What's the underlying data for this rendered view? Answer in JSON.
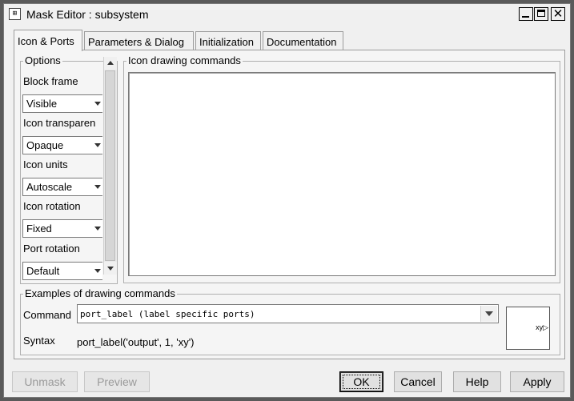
{
  "window": {
    "title": "Mask Editor : subsystem"
  },
  "tabs": [
    {
      "label": "Icon & Ports"
    },
    {
      "label": "Parameters & Dialog"
    },
    {
      "label": "Initialization"
    },
    {
      "label": "Documentation"
    }
  ],
  "options": {
    "legend": "Options",
    "fields": [
      {
        "label": "Block frame",
        "value": "Visible"
      },
      {
        "label": "Icon transparen",
        "value": "Opaque"
      },
      {
        "label": "Icon units",
        "value": "Autoscale"
      },
      {
        "label": "Icon rotation",
        "value": "Fixed"
      },
      {
        "label": "Port rotation",
        "value": "Default"
      }
    ]
  },
  "icon_drawing": {
    "legend": "Icon drawing commands",
    "value": ""
  },
  "examples": {
    "legend": "Examples of drawing commands",
    "command_label": "Command",
    "command_value": "port_label (label specific ports)",
    "syntax_label": "Syntax",
    "syntax_value": "port_label('output', 1, 'xy')",
    "preview_port_label": "xy"
  },
  "buttons": {
    "unmask": "Unmask",
    "preview": "Preview",
    "ok": "OK",
    "cancel": "Cancel",
    "help": "Help",
    "apply": "Apply"
  }
}
